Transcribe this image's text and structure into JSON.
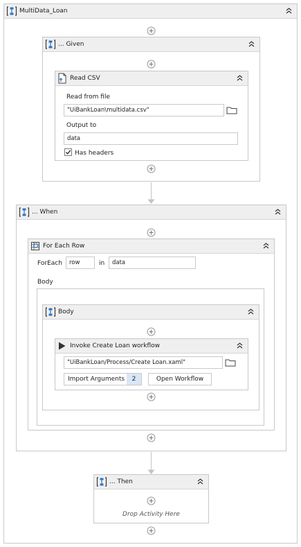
{
  "root": {
    "title": "MultiData_Loan"
  },
  "given": {
    "title": "... Given",
    "read_csv": {
      "title": "Read CSV",
      "read_from_file_label": "Read from file",
      "file_path": "\"UiBankLoan\\multidata.csv\"",
      "output_to_label": "Output to",
      "output_value": "data",
      "has_headers_label": "Has headers",
      "has_headers_checked": true
    }
  },
  "when": {
    "title": "... When",
    "for_each_row": {
      "title": "For Each Row",
      "foreach_label": "ForEach",
      "item_value": "row",
      "in_label": "in",
      "collection_value": "data",
      "body_label": "Body",
      "body": {
        "title": "Body",
        "invoke": {
          "title": "Invoke Create Loan workflow",
          "workflow_path": "\"UiBankLoan/Process/Create Loan.xaml\"",
          "import_arguments_label": "Import Arguments",
          "arguments_count": "2",
          "open_workflow_label": "Open Workflow"
        }
      }
    }
  },
  "then": {
    "title": "... Then",
    "drop_placeholder": "Drop Activity Here"
  },
  "colors": {
    "seq_blue": "#2e73c7",
    "border": "#c8c8c8",
    "header_bg": "#efefef",
    "badge_bg": "#d9e6f5"
  }
}
